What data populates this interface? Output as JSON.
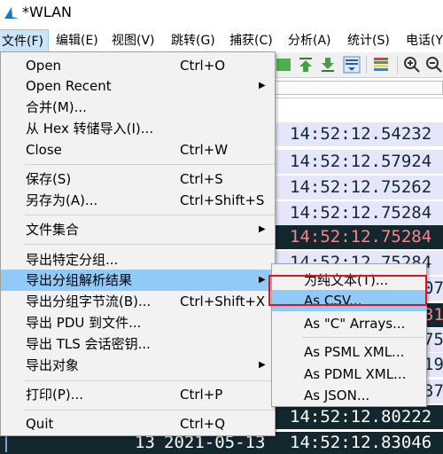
{
  "window": {
    "title": "*WLAN"
  },
  "menubar": [
    {
      "label": "文件(F)"
    },
    {
      "label": "编辑(E)"
    },
    {
      "label": "视图(V)"
    },
    {
      "label": "跳转(G)"
    },
    {
      "label": "捕获(C)"
    },
    {
      "label": "分析(A)"
    },
    {
      "label": "统计(S)"
    },
    {
      "label": "电话(Y"
    }
  ],
  "file_menu": {
    "items": [
      {
        "label": "Open",
        "shortcut": "Ctrl+O"
      },
      {
        "label": "Open Recent",
        "shortcut": ""
      },
      {
        "label": "合并(M)...",
        "shortcut": ""
      },
      {
        "label": "从 Hex 转储导入(I)...",
        "shortcut": ""
      },
      {
        "label": "Close",
        "shortcut": "Ctrl+W"
      },
      {
        "label": "保存(S)",
        "shortcut": "Ctrl+S"
      },
      {
        "label": "另存为(A)...",
        "shortcut": "Ctrl+Shift+S"
      },
      {
        "label": "文件集合",
        "shortcut": ""
      },
      {
        "label": "导出特定分组...",
        "shortcut": ""
      },
      {
        "label": "导出分组解析结果",
        "shortcut": ""
      },
      {
        "label": "导出分组字节流(B)...",
        "shortcut": "Ctrl+Shift+X"
      },
      {
        "label": "导出 PDU 到文件...",
        "shortcut": ""
      },
      {
        "label": "导出 TLS 会话密钥...",
        "shortcut": ""
      },
      {
        "label": "导出对象",
        "shortcut": ""
      },
      {
        "label": "打印(P)...",
        "shortcut": "Ctrl+P"
      },
      {
        "label": "Quit",
        "shortcut": "Ctrl+Q"
      }
    ]
  },
  "export_submenu": {
    "items": [
      {
        "label": "为纯文本(T)..."
      },
      {
        "label": "As CSV..."
      },
      {
        "label": "As \"C\" Arrays..."
      },
      {
        "label": "As PSML XML..."
      },
      {
        "label": "As PDML XML..."
      },
      {
        "label": "As JSON..."
      }
    ]
  },
  "packets": [
    {
      "time": "14:52:12.54232"
    },
    {
      "time": "14:52:12.57924"
    },
    {
      "time": "14:52:12.75262"
    },
    {
      "time": "14:52:12.75284"
    },
    {
      "time": "14:52:12.75284"
    },
    {
      "time": "14:52:12.75284"
    },
    {
      "time": "07"
    },
    {
      "time": "31"
    },
    {
      "time": "75"
    },
    {
      "time": "19"
    },
    {
      "time": "37"
    },
    {
      "time": "14:52:12.80222"
    }
  ],
  "last_row": {
    "num": "13",
    "date": "2021-05-13",
    "time": "14:52:12.83046"
  },
  "colors": {
    "highlight": "#91c9f7",
    "menubar_active": "#cce4f7",
    "dark_row": "#12272e",
    "light_row": "#e6e6fa",
    "red_box": "#e0141e"
  },
  "icons": [
    "shark-fin-icon",
    "go-top-icon",
    "go-bottom-icon",
    "autoscroll-icon",
    "colorize-icon",
    "zoom-in-icon",
    "zoom-out-icon"
  ]
}
